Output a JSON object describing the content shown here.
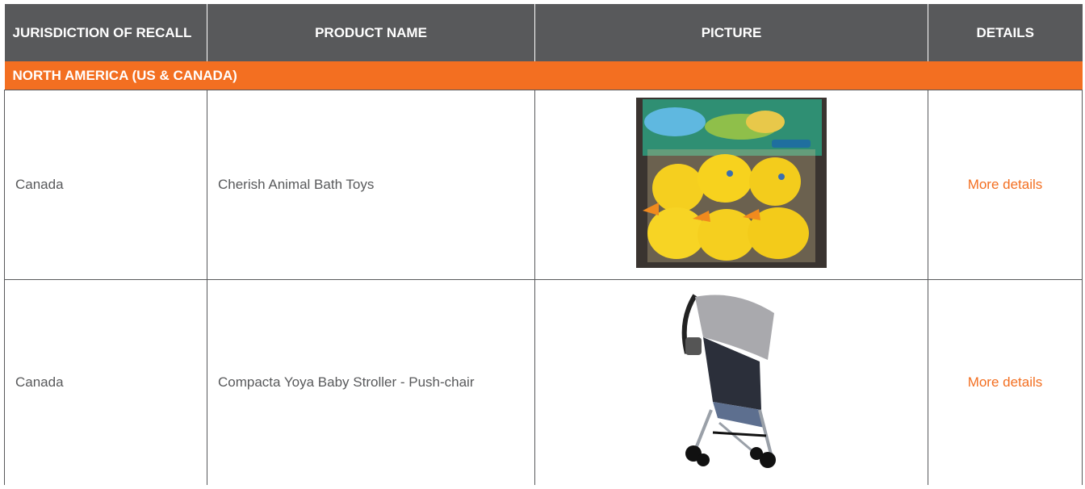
{
  "table": {
    "headers": [
      "JURISDICTION OF RECALL",
      "PRODUCT NAME",
      "PICTURE",
      "DETAILS"
    ],
    "region": "NORTH AMERICA (US & CANADA)",
    "rows": [
      {
        "jurisdiction": "Canada",
        "product": "Cherish Animal Bath Toys",
        "picture": "rubber-ducks-package-image",
        "details_link": "More details"
      },
      {
        "jurisdiction": "Canada",
        "product": "Compacta Yoya Baby Stroller - Push-chair",
        "picture": "baby-stroller-image",
        "details_link": "More details"
      }
    ]
  },
  "colors": {
    "header_bg": "#58595b",
    "region_bg": "#f36f21",
    "link": "#f36f21",
    "text": "#58595b"
  }
}
